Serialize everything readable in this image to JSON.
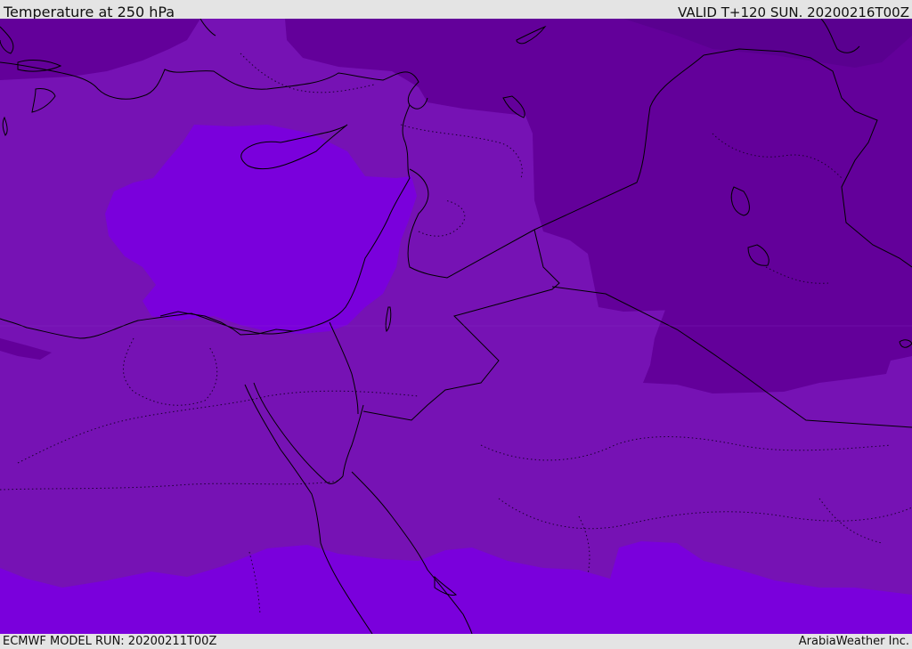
{
  "header": {
    "title": "Temperature at 250 hPa",
    "valid_time": "VALID T+120 SUN. 20200216T00Z"
  },
  "footer": {
    "model_run": "ECMWF MODEL RUN: 20200211T00Z",
    "credit": "ArabiaWeather Inc."
  },
  "map": {
    "colors": {
      "cold_dark": "#5a0090",
      "cold": "#63009a",
      "mid": "#7612b4",
      "warm": "#7a00dc",
      "coast": "#000000"
    }
  }
}
